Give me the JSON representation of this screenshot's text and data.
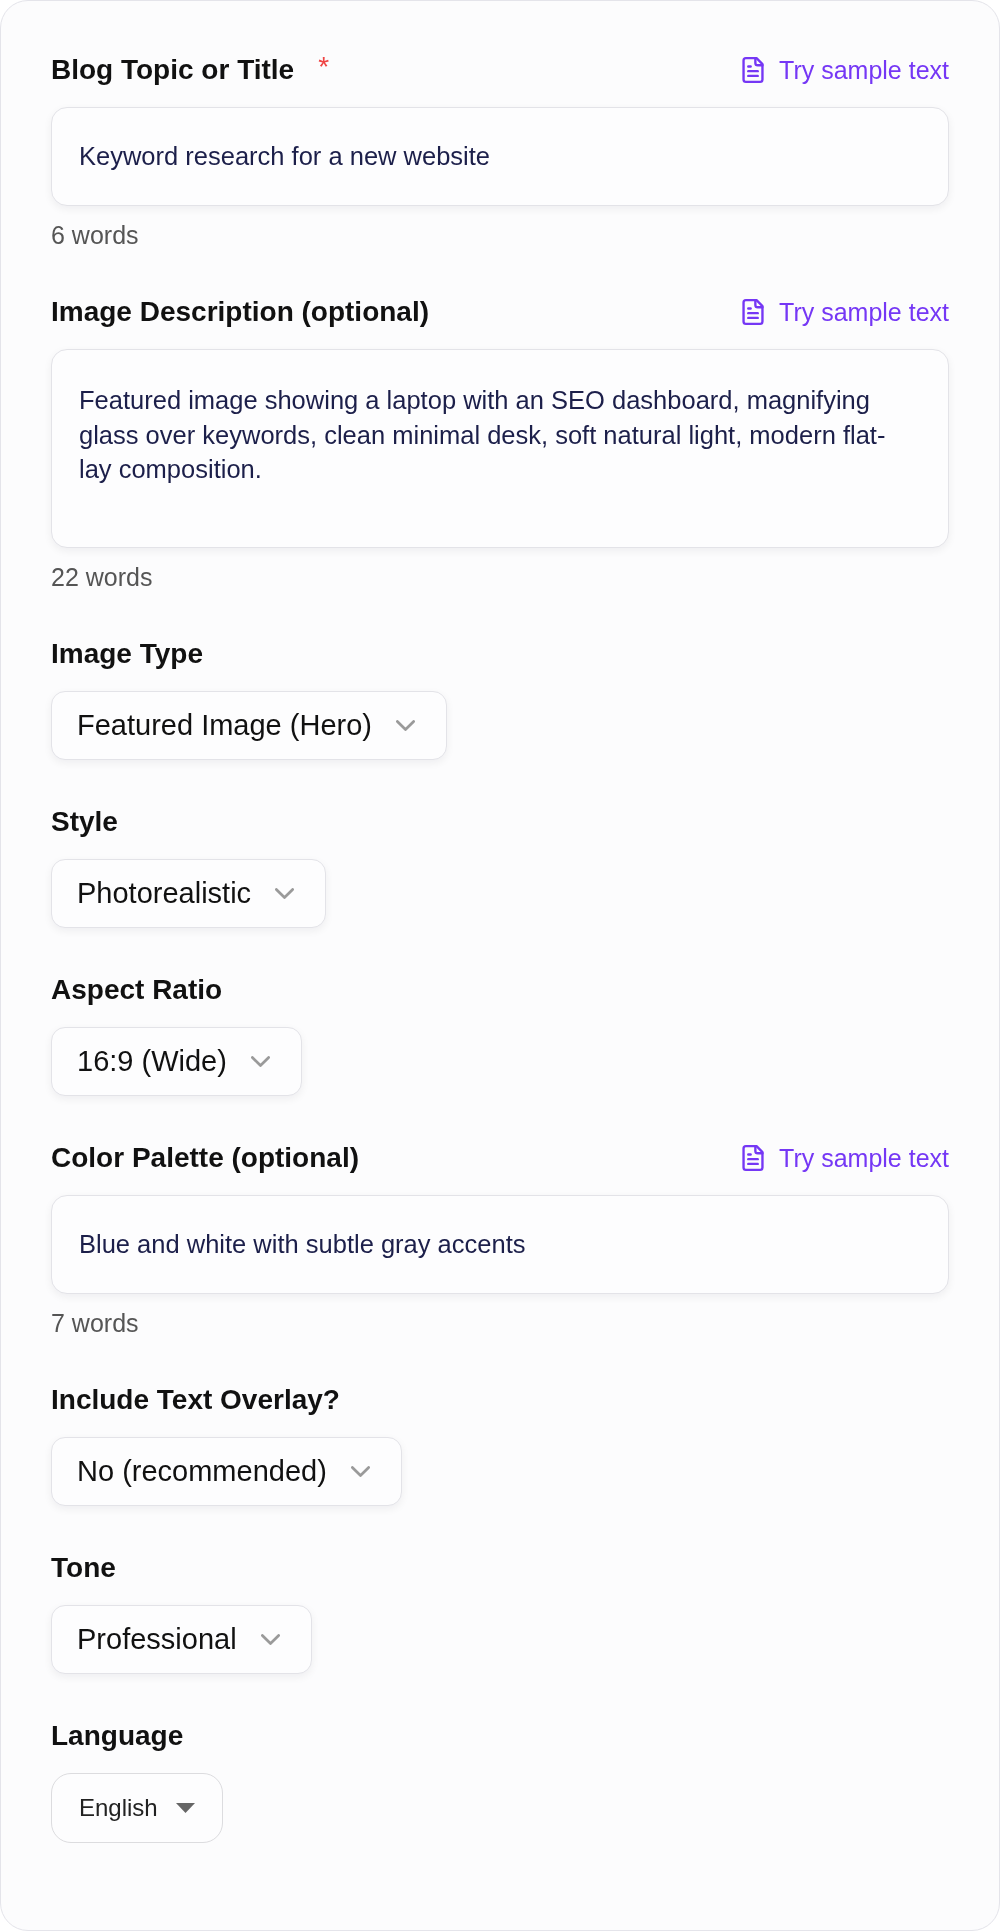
{
  "form": {
    "fields": [
      {
        "kind": "text",
        "label": "Blog Topic or Title",
        "required_mark": "*",
        "sample_link": "Try sample text",
        "value": "Keyword research for a new website",
        "word_count": "6 words"
      },
      {
        "kind": "multiline",
        "label": "Image Description (optional)",
        "sample_link": "Try sample text",
        "value": "Featured image showing a laptop with an SEO dashboard, magnifying glass over keywords, clean minimal desk, soft natural light, modern flat-lay composition.",
        "word_count": "22 words"
      },
      {
        "kind": "select",
        "label": "Image Type",
        "value": "Featured Image (Hero)"
      },
      {
        "kind": "select",
        "label": "Style",
        "value": "Photorealistic"
      },
      {
        "kind": "select",
        "label": "Aspect Ratio",
        "value": "16:9 (Wide)"
      },
      {
        "kind": "text",
        "label": "Color Palette (optional)",
        "sample_link": "Try sample text",
        "value": "Blue and white with subtle gray accents",
        "word_count": "7 words"
      },
      {
        "kind": "select",
        "label": "Include Text Overlay?",
        "value": "No (recommended)"
      },
      {
        "kind": "select",
        "label": "Tone",
        "value": "Professional"
      },
      {
        "kind": "native",
        "label": "Language",
        "value": "English"
      }
    ]
  }
}
